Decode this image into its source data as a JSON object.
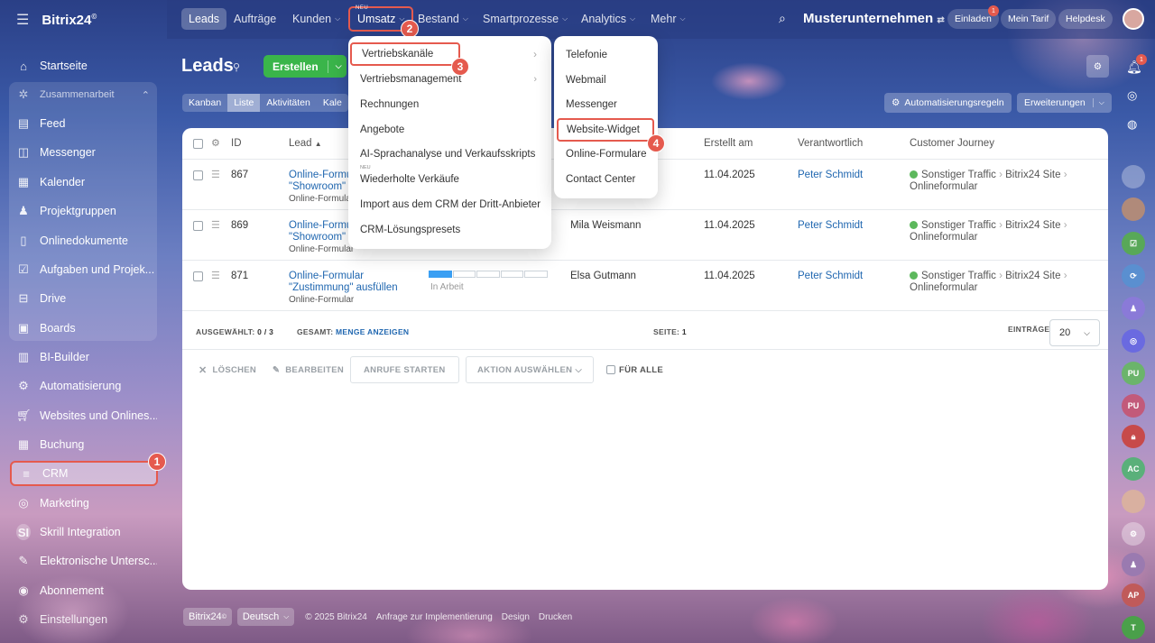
{
  "app": {
    "name": "Bitrix24",
    "logo_suffix": "©"
  },
  "sidebar": {
    "group_header": "Zusammenarbeit",
    "items": [
      {
        "label": "Startseite",
        "icon": "home-icon"
      },
      {
        "label": "Feed",
        "icon": "feed-icon"
      },
      {
        "label": "Messenger",
        "icon": "chat-icon"
      },
      {
        "label": "Kalender",
        "icon": "calendar-icon"
      },
      {
        "label": "Projektgruppen",
        "icon": "group-icon"
      },
      {
        "label": "Onlinedokumente",
        "icon": "document-icon"
      },
      {
        "label": "Aufgaben und Projek...",
        "icon": "task-icon"
      },
      {
        "label": "Drive",
        "icon": "drive-icon"
      },
      {
        "label": "Boards",
        "icon": "board-icon"
      },
      {
        "label": "BI-Builder",
        "icon": "chart-icon"
      },
      {
        "label": "Automatisierung",
        "icon": "robot-icon"
      },
      {
        "label": "Websites und Onlines...",
        "icon": "cart-icon"
      },
      {
        "label": "Buchung",
        "icon": "booking-icon"
      },
      {
        "label": "CRM",
        "icon": "filter-icon"
      },
      {
        "label": "Marketing",
        "icon": "target-icon"
      },
      {
        "label": "Skrill Integration",
        "icon": "si-badge",
        "badge": "SI"
      },
      {
        "label": "Elektronische Untersc...",
        "icon": "sign-icon"
      },
      {
        "label": "Abonnement",
        "icon": "subscription-icon"
      },
      {
        "label": "Einstellungen",
        "icon": "gear-icon"
      }
    ]
  },
  "topnav": {
    "items": [
      "Leads",
      "Aufträge",
      "Kunden",
      "Umsatz",
      "Bestand",
      "Smartprozesse",
      "Analytics",
      "Mehr"
    ],
    "neu": "NEU",
    "company": "Musterunternehmen",
    "invite": "Einladen",
    "invite_badge": "1",
    "tariff": "Mein Tarif",
    "helpdesk": "Helpdesk"
  },
  "page": {
    "title": "Leads",
    "create": "Erstellen",
    "view_tabs": [
      "Kanban",
      "Liste",
      "Aktivitäten",
      "Kale"
    ],
    "automation": "Automatisierungsregeln",
    "extensions": "Erweiterungen"
  },
  "table": {
    "headers": {
      "id": "ID",
      "lead": "Lead",
      "created": "Erstellt am",
      "responsible": "Verantwortlich",
      "journey": "Customer Journey"
    },
    "rows": [
      {
        "id": "867",
        "lead1": "Online-Formul",
        "lead2": "\"Showroom\"",
        "source": "Online-Formular",
        "contact": "",
        "created": "11.04.2025",
        "responsible": "Peter Schmidt",
        "journey1": "Sonstiger Traffic",
        "journey2": "Bitrix24 Site",
        "journey3": "Onlineformular"
      },
      {
        "id": "869",
        "lead1": "Online-Formu",
        "lead2": "\"Showroom\"",
        "source": "Online-Formular",
        "contact": "Mila Weismann",
        "created": "11.04.2025",
        "responsible": "Peter Schmidt",
        "journey1": "Sonstiger Traffic",
        "journey2": "Bitrix24 Site",
        "journey3": "Onlineformular"
      },
      {
        "id": "871",
        "lead1": "Online-Formular",
        "lead2": "\"Zustimmung\" ausfüllen",
        "source": "Online-Formular",
        "status": "In Arbeit",
        "contact": "Elsa Gutmann",
        "created": "11.04.2025",
        "responsible": "Peter Schmidt",
        "journey1": "Sonstiger Traffic",
        "journey2": "Bitrix24 Site",
        "journey3": "Onlineformular"
      }
    ],
    "progress_fraction": 0.2,
    "footer": {
      "selected_label": "AUSGEWÄHLT:",
      "selected_value": "0 / 3",
      "total_label": "GESAMT:",
      "total_link": "MENGE ANZEIGEN",
      "page_label": "SEITE:",
      "page_value": "1",
      "entries_label": "EINTRÄGE",
      "entries_value": "20"
    },
    "actions": {
      "delete": "LÖSCHEN",
      "edit": "BEARBEITEN",
      "calls": "ANRUFE STARTEN",
      "select_action": "AKTION AUSWÄHLEN",
      "for_all": "FÜR ALLE"
    }
  },
  "umsatz_menu": [
    {
      "label": "Vertriebskanäle",
      "submenu": true
    },
    {
      "label": "Vertriebsmanagement",
      "submenu": true
    },
    {
      "label": "Rechnungen"
    },
    {
      "label": "Angebote"
    },
    {
      "label": "AI-Sprachanalyse und Verkaufsskripts"
    },
    {
      "label": "Wiederholte Verkäufe",
      "neu": "NEU"
    },
    {
      "label": "Import aus dem CRM der Dritt-Anbieter"
    },
    {
      "label": "CRM-Lösungspresets"
    }
  ],
  "channels_menu": [
    "Telefonie",
    "Webmail",
    "Messenger",
    "Website-Widget",
    "Online-Formulare",
    "Contact Center"
  ],
  "steps": [
    "1",
    "2",
    "3",
    "4"
  ],
  "rail": [
    "PU",
    "PU",
    "AC",
    "AP",
    "T"
  ],
  "rail_badge": "1",
  "bottom": {
    "brand": "Bitrix24",
    "lang": "Deutsch",
    "copyright": "© 2025 Bitrix24",
    "impl": "Anfrage zur Implementierung",
    "design": "Design",
    "print": "Drucken"
  },
  "colors": {
    "accent_red": "#e55a4e",
    "green": "#3ab54a",
    "link": "#2067b0"
  }
}
